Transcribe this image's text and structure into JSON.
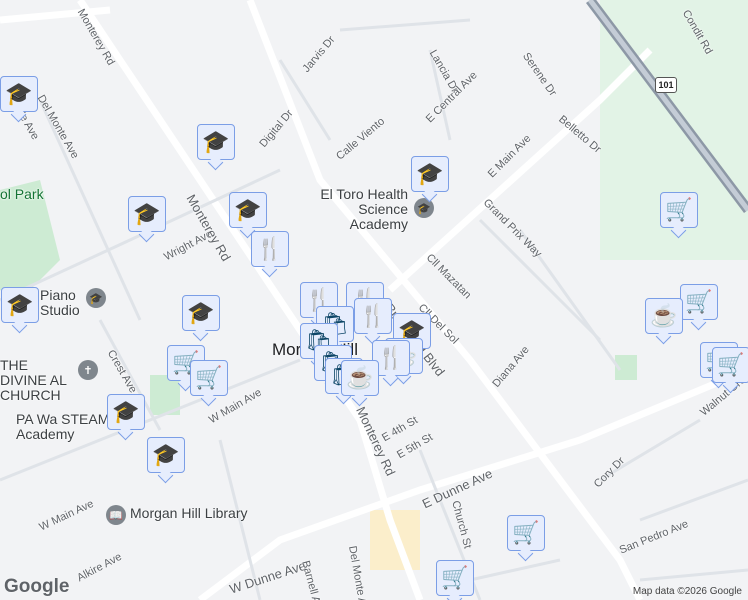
{
  "map": {
    "city_label": "Morgan Hill",
    "attribution": "Map data ©2026 Google",
    "logo": "Google",
    "highway_shield": "101",
    "poi": [
      {
        "name": "El Toro Health Science Academy",
        "icon": "school-icon"
      },
      {
        "name": "Piano Studio",
        "icon": "school-icon"
      },
      {
        "name": "THE DIVINE AL CHURCH",
        "icon": "church-icon"
      },
      {
        "name": "PA Wa STEAM Academy",
        "icon": "school-icon"
      },
      {
        "name": "Morgan Hill Library",
        "icon": "library-icon"
      },
      {
        "name": "ol Park",
        "icon": "park"
      }
    ],
    "streets": [
      "Monterey Rd",
      "Jarvis Dr",
      "Lancia Dr",
      "Condit Rd",
      "Serene Dr",
      "E Main Ave",
      "E Central Ave",
      "Digital Dr",
      "Calle Viento",
      "Belletto Dr",
      "Del Monte Ave",
      "Hale Ave",
      "Wright Ave",
      "Grand Prix Way",
      "Cll Mazatan",
      "Cll Del Sol",
      "Butterfield Blvd",
      "Crest Ave",
      "Diana Ave",
      "W Main Ave",
      "E 4th St",
      "E 5th St",
      "E Dunne Ave",
      "Walnut Grove Dr",
      "Cory Dr",
      "Church St",
      "San Pedro Ave",
      "W Dunne Ave",
      "Alkire Ave",
      "Barnell Ave",
      "Del Monte Ave",
      "Monterey Rd",
      "W Main Ave"
    ],
    "marker_icons": {
      "school": "graduation-cap-icon",
      "shopping": "shopping-cart-icon",
      "restaurant": "fork-knife-icon",
      "store": "shopping-bag-icon",
      "cafe": "coffee-cup-icon"
    },
    "colors": {
      "marker_bg": "#e6edfd",
      "marker_border": "#7b9ee6",
      "marker_icon": "#0d4667",
      "road": "#ffffff",
      "park": "#cdebd3"
    }
  }
}
